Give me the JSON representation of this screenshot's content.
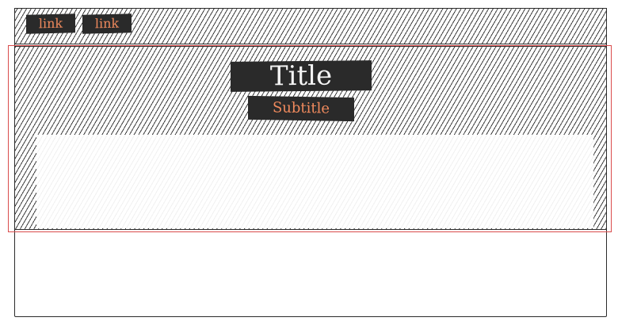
{
  "nav": {
    "links": [
      {
        "label": "link"
      },
      {
        "label": "link"
      }
    ]
  },
  "hero": {
    "title": "Title",
    "subtitle": "Subtitle"
  },
  "colors": {
    "link_text": "#f08a5d",
    "block_fill": "#2a2a2a",
    "hero_outline": "#d94c4c",
    "stroke": "#2b2b2b"
  }
}
